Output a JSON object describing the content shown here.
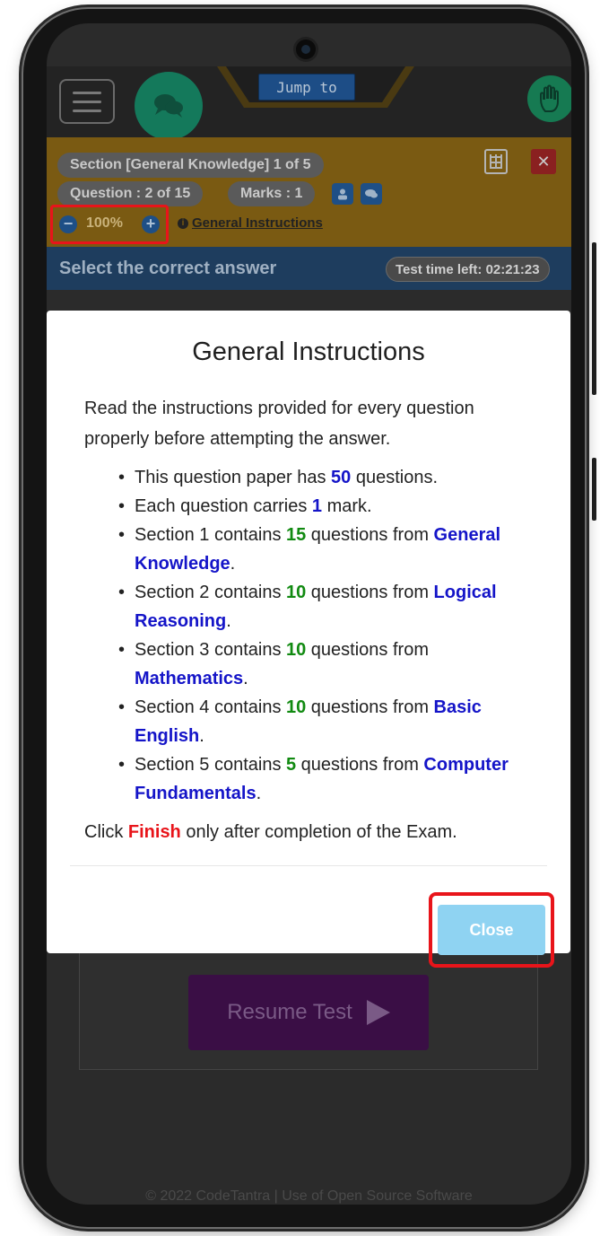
{
  "header": {
    "jump_label": "Jump to"
  },
  "section": {
    "section_label": "Section [General Knowledge] 1 of 5",
    "question_label": "Question : 2 of 15",
    "marks_label": "Marks : 1",
    "zoom_value": "100%",
    "zoom_minus": "−",
    "zoom_plus": "+",
    "instructions_link": "General Instructions",
    "close_symbol": "✕"
  },
  "answer_bar": {
    "title": "Select the correct answer",
    "timer": "Test time left: 02:21:23"
  },
  "background": {
    "resume_label": "Resume Test",
    "footer": "© 2022 CodeTantra | Use of Open Source Software"
  },
  "modal": {
    "title": "General Instructions",
    "intro": "Read the instructions provided for every question properly before attempting the answer.",
    "items": [
      {
        "pre": "This question paper has ",
        "num": "50",
        "post": " questions.",
        "subject": ""
      },
      {
        "pre": "Each question carries ",
        "num": "1",
        "post": " mark.",
        "subject": ""
      },
      {
        "pre": "Section 1 contains ",
        "num": "15",
        "post": " questions from ",
        "subject": "General Knowledge"
      },
      {
        "pre": "Section 2 contains ",
        "num": "10",
        "post": " questions from ",
        "subject": "Logical Reasoning"
      },
      {
        "pre": "Section 3 contains ",
        "num": "10",
        "post": " questions from ",
        "subject": "Mathematics"
      },
      {
        "pre": "Section 4 contains ",
        "num": "10",
        "post": " questions from ",
        "subject": "Basic English"
      },
      {
        "pre": "Section 5 contains ",
        "num": "5",
        "post": " questions from ",
        "subject": "Computer Fundamentals"
      }
    ],
    "footer_pre": "Click ",
    "footer_finish": "Finish",
    "footer_post": " only after completion of the Exam.",
    "close_label": "Close"
  },
  "colors": {
    "section_bg": "#7a5a12",
    "answer_bar_bg": "#1e3d5e",
    "highlight": "#e8141a",
    "close_button": "#8fd3f2",
    "number_blue": "#1414c8",
    "number_green": "#118a11"
  }
}
